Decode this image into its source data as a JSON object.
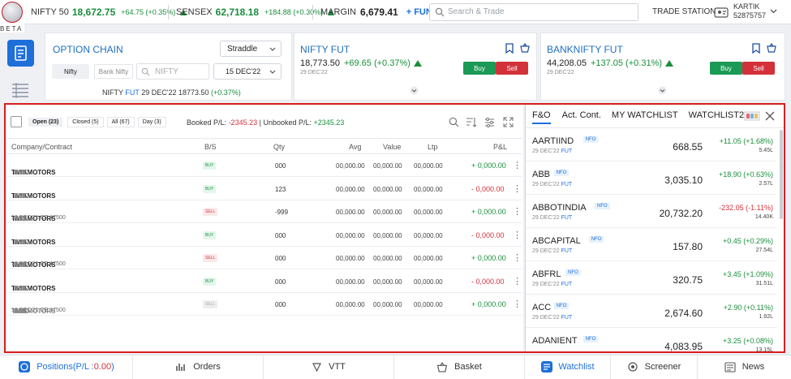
{
  "header": {
    "beta": "BETA",
    "nifty": {
      "label": "NIFTY 50",
      "value": "18,672.75",
      "change": "+64.75 (+0.35%)"
    },
    "sensex": {
      "label": "SENSEX",
      "value": "62,718.18",
      "change": "+184.88 (+0.30%)"
    },
    "margin": {
      "label": "MARGIN",
      "value": "6,679.41",
      "funds": "+ FUNDS"
    },
    "search_placeholder": "Search & Trade",
    "trade_station": "TRADE STATION",
    "user": {
      "name": "KARTIK",
      "id": "52875757"
    }
  },
  "option_chain": {
    "title": "OPTION CHAIN",
    "strategy": "Straddle",
    "tabs": [
      "Nifty",
      "Bank Nifty"
    ],
    "search": "NIFTY",
    "expiry": "15 DEC'22",
    "fut_line": {
      "a": "NIFTY",
      "b": "FUT",
      "c": "29 DEC'22 18773.50",
      "d": "(+0.37%)"
    }
  },
  "nifty_fut": {
    "title": "NIFTY FUT",
    "price": "18,773.50",
    "change": "+69.65 (+0.37%)",
    "date": "29 DEC'22",
    "buy": "Buy",
    "sell": "Sell"
  },
  "banknifty_fut": {
    "title": "BANKNIFTY FUT",
    "price": "44,208.05",
    "change": "+137.05 (+0.31%)",
    "date": "29 DEC'22",
    "buy": "Buy",
    "sell": "Sell"
  },
  "positions": {
    "filters": [
      "Open (23)",
      "Closed (5)",
      "All (67)",
      "Day (3)"
    ],
    "booked_label": "Booked P/L:",
    "booked": "-2345.23",
    "unbooked_label": "| Unbooked P/L:",
    "unbooked": "+2345.23",
    "columns": [
      "Company/Contract",
      "B/S",
      "Qty",
      "Avg",
      "Value",
      "Ltp",
      "P&L"
    ],
    "rows": [
      {
        "name": "TATAMOTORS",
        "sub": "",
        "tags": [
          "NSE",
          "DEL",
          "RL",
          "AMO"
        ],
        "side": "BUY",
        "qty": "000",
        "avg": "00,000.00",
        "value": "00,000.00",
        "ltp": "00,000.00",
        "pnl": "+ 0,000.00"
      },
      {
        "name": "TATAMOTORS",
        "sub": "",
        "tags": [
          "NSE",
          "DEL",
          "RL",
          "AMO"
        ],
        "side": "BUY",
        "qty": "123",
        "avg": "00,000.00",
        "value": "00,000.00",
        "ltp": "00,000.00",
        "pnl": "- 0,000.00"
      },
      {
        "name": "TATAMOTORS",
        "sub": "12 DEC'21 CE 17500",
        "tags": [
          "NSE",
          "DEL"
        ],
        "side": "SELL",
        "qty": "-999",
        "avg": "00,000.00",
        "value": "00,000.00",
        "ltp": "00,000.00",
        "pnl": "+ 0,000.00"
      },
      {
        "name": "TATAMOTORS",
        "sub": "",
        "tags": [
          "NSE",
          "DEL",
          "RL",
          "AMO"
        ],
        "side": "BUY",
        "qty": "000",
        "avg": "00,000.00",
        "value": "00,000.00",
        "ltp": "00,000.00",
        "pnl": "- 0,000.00"
      },
      {
        "name": "TATAMOTORS",
        "sub": "12 DEC'21 CE 17500",
        "tags": [
          "NSE",
          "DEL",
          "RL",
          "AMO"
        ],
        "side": "SELL",
        "qty": "000",
        "avg": "00,000.00",
        "value": "00,000.00",
        "ltp": "00,000.00",
        "pnl": "+ 0,000.00"
      },
      {
        "name": "TATAMOTORS",
        "sub": "",
        "tags": [
          "NSE",
          "DEL",
          "RL",
          "AMO"
        ],
        "side": "BUY",
        "qty": "000",
        "avg": "00,000.00",
        "value": "00,000.00",
        "ltp": "00,000.00",
        "pnl": "- 0,000.00"
      },
      {
        "name": "TATAMOTORS",
        "sub": "12 DEC'21 CE 17500",
        "tags": [
          "NSE",
          "DEL",
          "RL",
          "AMO"
        ],
        "side": "SELL",
        "qty": "000",
        "avg": "00,000.00",
        "value": "00,000.00",
        "ltp": "00,000.00",
        "pnl": "+ 0,000.00",
        "dim": true
      }
    ]
  },
  "watchlist": {
    "tabs": [
      "F&O",
      "Act. Cont.",
      "MY WATCHLIST",
      "WATCHLIST2"
    ],
    "items": [
      {
        "name": "AARTIIND",
        "badge": "NFO",
        "sub": "29 DEC'22",
        "sub2": "FUT",
        "price": "668.55",
        "change": "+11.05 (+1.68%)",
        "vol": "5.45L",
        "up": true
      },
      {
        "name": "ABB",
        "badge": "NFO",
        "sub": "29 DEC'22",
        "sub2": "FUT",
        "price": "3,035.10",
        "change": "+18.90 (+0.63%)",
        "vol": "2.57L",
        "up": true
      },
      {
        "name": "ABBOTINDIA",
        "badge": "NFO",
        "sub": "29 DEC'22",
        "sub2": "FUT",
        "price": "20,732.20",
        "change": "-232.05 (-1.11%)",
        "vol": "14.40K",
        "up": false
      },
      {
        "name": "ABCAPITAL",
        "badge": "NFO",
        "sub": "29 DEC'22",
        "sub2": "FUT",
        "price": "157.80",
        "change": "+0.45 (+0.29%)",
        "vol": "27.54L",
        "up": true
      },
      {
        "name": "ABFRL",
        "badge": "NFO",
        "sub": "29 DEC'22",
        "sub2": "FUT",
        "price": "320.75",
        "change": "+3.45 (+1.09%)",
        "vol": "31.51L",
        "up": true
      },
      {
        "name": "ACC",
        "badge": "NFO",
        "sub": "29 DEC'22",
        "sub2": "FUT",
        "price": "2,674.60",
        "change": "+2.90 (+0.11%)",
        "vol": "1.92L",
        "up": true
      },
      {
        "name": "ADANIENT",
        "badge": "NFO",
        "sub": "",
        "sub2": "",
        "price": "4,083.95",
        "change": "+3.25 (+0.08%)",
        "vol": "13.15L",
        "up": true
      }
    ]
  },
  "bottom_nav": {
    "positions": "Positions(P/L : ",
    "positions_pl": "0.00",
    "positions_end": ")",
    "orders": "Orders",
    "vtt": "VTT",
    "basket": "Basket",
    "watchlist": "Watchlist",
    "screener": "Screener",
    "news": "News"
  },
  "colors": {
    "green": "#1a8e3c",
    "red": "#d3313a",
    "blue": "#1e6fd9",
    "accent_border": "#d81e1e"
  }
}
